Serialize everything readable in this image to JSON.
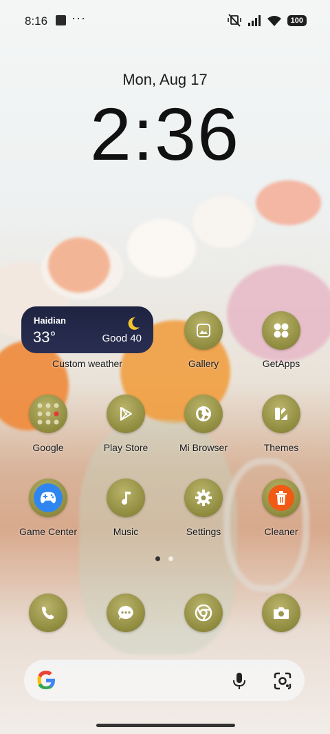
{
  "status_bar": {
    "time": "8:16",
    "notif_more": "···",
    "battery": "100",
    "icons": [
      "notification-square-icon",
      "mute-vibrate-icon",
      "signal-icon",
      "wifi-icon",
      "battery-icon"
    ]
  },
  "lockclock": {
    "date": "Mon, Aug 17",
    "time": "2:36"
  },
  "weather_widget": {
    "city": "Haidian",
    "temp": "33°",
    "aqi": "Good 40",
    "label": "Custom weather",
    "icon": "moon-icon"
  },
  "apps": {
    "gallery": "Gallery",
    "getapps": "GetApps",
    "google": "Google",
    "playstore": "Play Store",
    "mibrowser": "Mi Browser",
    "themes": "Themes",
    "gamecenter": "Game Center",
    "music": "Music",
    "settings": "Settings",
    "cleaner": "Cleaner"
  },
  "dock": [
    "phone-icon",
    "messages-icon",
    "chrome-icon",
    "camera-icon"
  ],
  "page_indicator": {
    "pages": 2,
    "active": 1
  },
  "searchbar": {
    "icons": [
      "google-g-icon",
      "microphone-icon",
      "lens-icon"
    ]
  },
  "colors": {
    "icon_olive": "#9c9750",
    "weather_bg": "#1d2340",
    "cleaner_orange": "#f05a14"
  }
}
